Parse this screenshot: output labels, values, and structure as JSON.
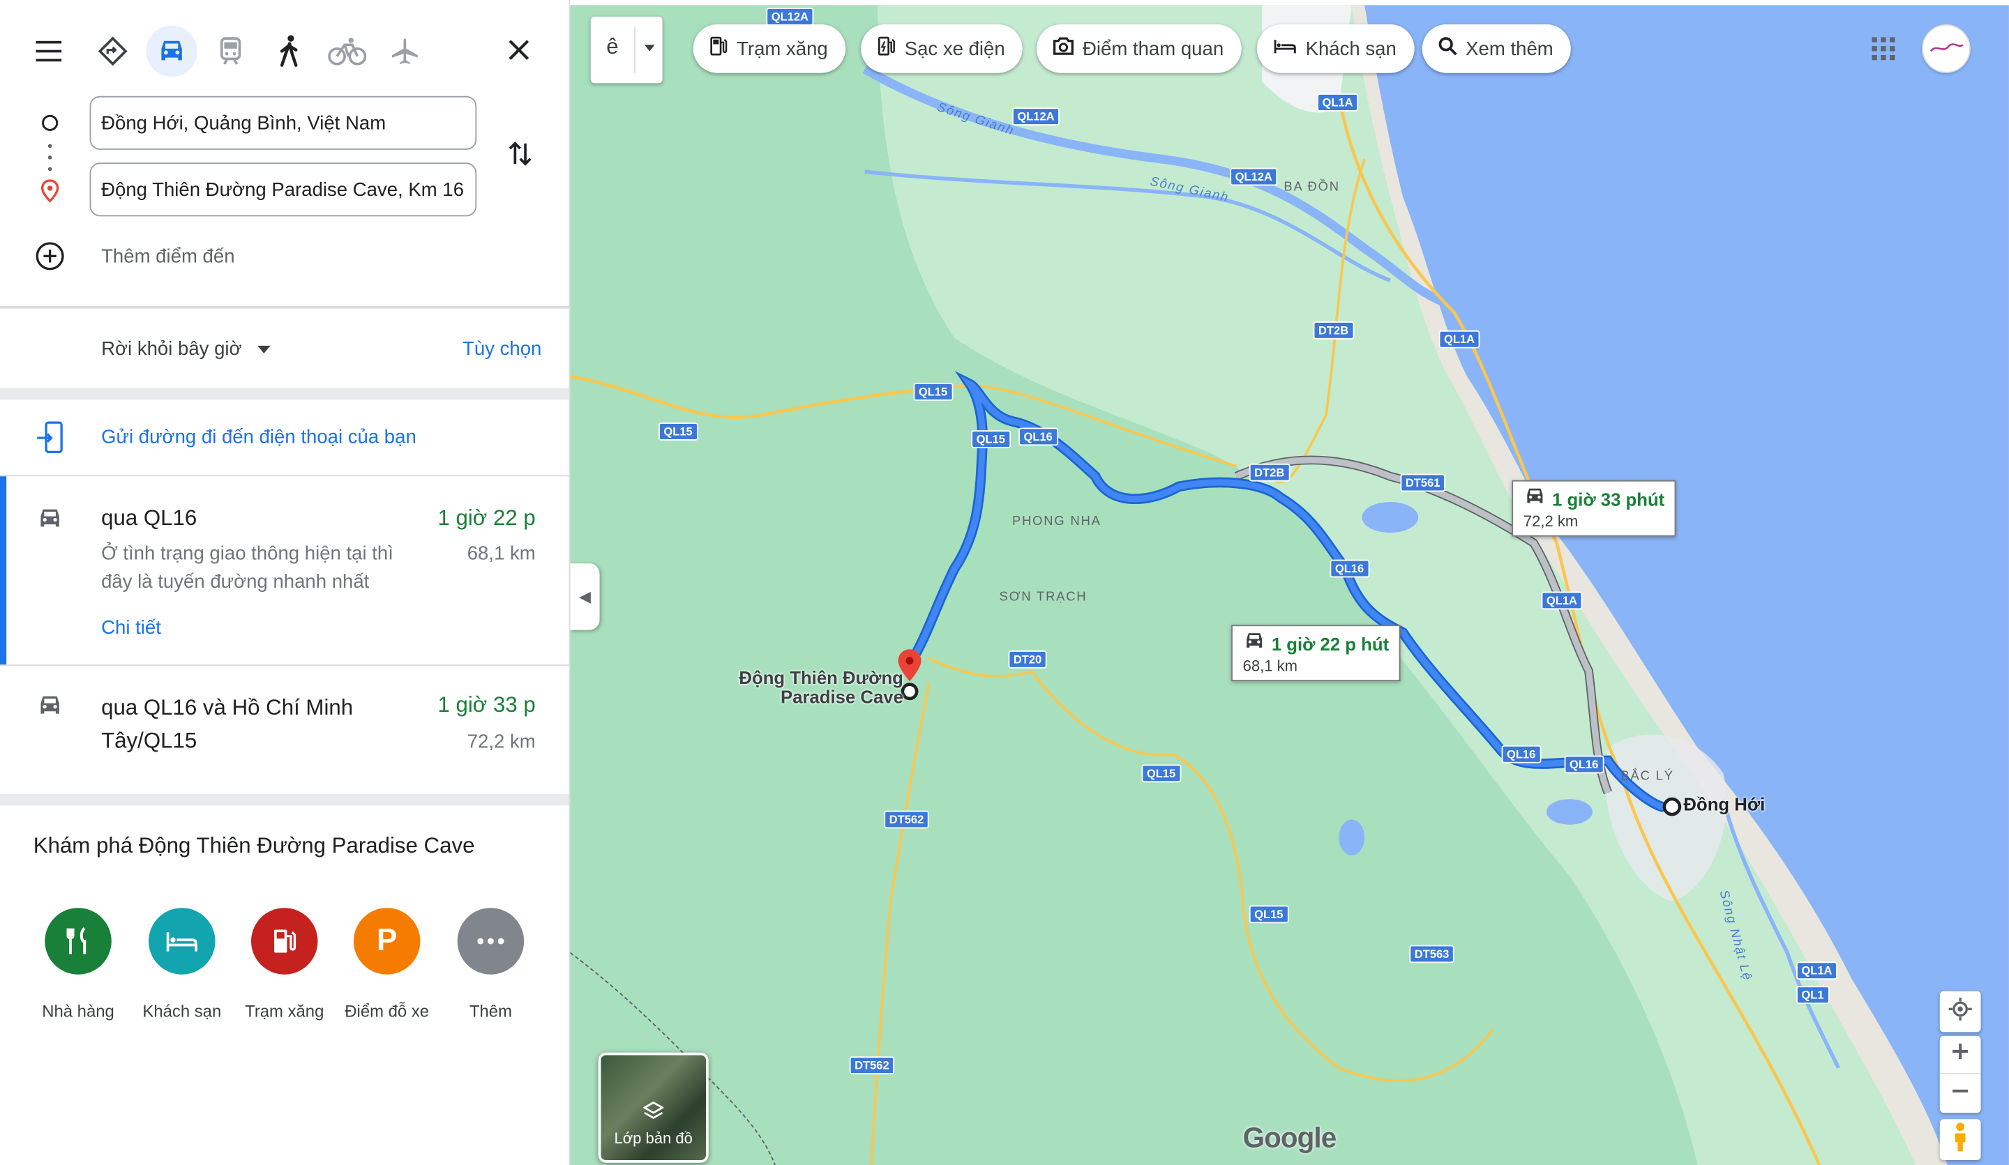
{
  "modes": {
    "menu": "menu-icon",
    "best": "directions-icon",
    "driving": "car-icon",
    "transit": "train-icon",
    "walking": "walk-icon",
    "cycling": "bike-icon",
    "flight": "plane-icon",
    "close": "close-icon"
  },
  "route_inputs": {
    "origin": "Đồng Hới, Quảng Bình, Việt Nam",
    "destination": "Động Thiên Đường Paradise Cave, Km 16",
    "add_destination": "Thêm điểm đến"
  },
  "depart": {
    "label": "Rời khỏi bây giờ",
    "options": "Tùy chọn"
  },
  "send_to_phone": "Gửi đường đi đến điện thoại của bạn",
  "routes": [
    {
      "title": "qua QL16",
      "time": "1 giờ 22 p",
      "distance": "68,1 km",
      "note": "Ở tình trạng giao thông hiện tại thì đây là tuyến đường nhanh nhất",
      "details": "Chi tiết"
    },
    {
      "title": "qua QL16 và Hồ Chí Minh Tây/QL15",
      "time": "1 giờ 33 p",
      "distance": "72,2 km"
    }
  ],
  "explore": {
    "title": "Khám phá Động Thiên Đường Paradise Cave",
    "categories": [
      {
        "label": "Nhà hàng",
        "color": "#188038",
        "icon": "restaurant-icon"
      },
      {
        "label": "Khách sạn",
        "color": "#12a4af",
        "icon": "hotel-icon"
      },
      {
        "label": "Trạm xăng",
        "color": "#c5221f",
        "icon": "gas-icon"
      },
      {
        "label": "Điểm đỗ xe",
        "color": "#f57c00",
        "icon": "parking-icon"
      },
      {
        "label": "Thêm",
        "color": "#80868b",
        "icon": "more-icon"
      }
    ]
  },
  "map": {
    "input_tool": "ê",
    "chips": [
      "Trạm xăng",
      "Sạc xe điện",
      "Điểm tham quan",
      "Khách sạn",
      "Xem thêm"
    ],
    "route_labels": [
      {
        "time": "1 giờ 22 p hút",
        "distance": "68,1 km"
      },
      {
        "time": "1 giờ 33 phút",
        "distance": "72,2 km"
      }
    ],
    "places": {
      "cave": "Động Thiên Đường Paradise Cave",
      "dong_hoi": "Đồng Hới",
      "phong_nha": "PHONG NHA",
      "son_trach": "SƠN TRẠCH",
      "ba_don": "BA ĐỒN",
      "bac_ly": "BẮC LÝ",
      "song_gianh_1": "Sông Gianh",
      "song_gianh_2": "Sông Gianh",
      "song_nhat_le": "Sông Nhật Lệ"
    },
    "road_shields": [
      "QL12A",
      "QL12A",
      "QL12A",
      "QL1A",
      "QL1A",
      "QL1A",
      "QL1A",
      "QL1",
      "DT2B",
      "DT2B",
      "DT561",
      "QL15",
      "QL15",
      "QL15",
      "QL15",
      "QL15",
      "QL16",
      "QL16",
      "QL16",
      "QL16",
      "DT20",
      "DT562",
      "DT562",
      "DT563"
    ],
    "layers_label": "Lớp bản đồ",
    "logo": "Google"
  },
  "colors": {
    "accent": "#1a73e8",
    "route": "#1a73e8",
    "alt_route": "#9e9e9e",
    "water": "#8ab4f8",
    "land": "#a8dfbd"
  }
}
